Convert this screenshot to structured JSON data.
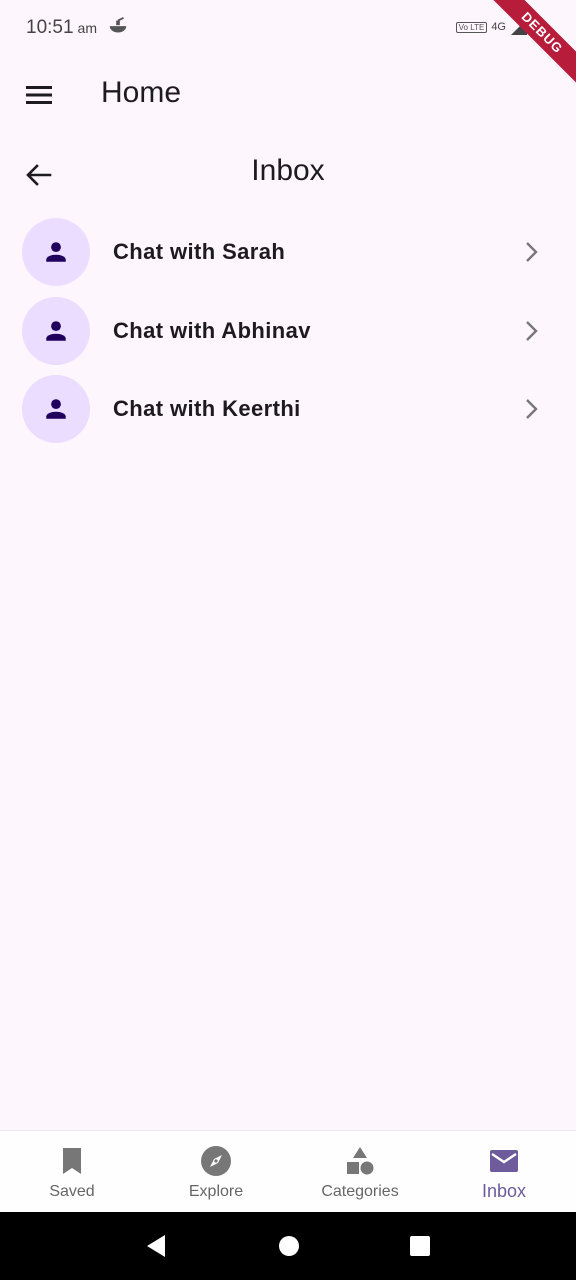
{
  "status": {
    "time": "10:51",
    "ampm": "am",
    "volte": "Vo LTE",
    "network": "4G"
  },
  "debug_label": "DEBUG",
  "app_bar": {
    "title": "Home"
  },
  "page": {
    "title": "Inbox"
  },
  "chats": [
    {
      "label": "Chat with Sarah"
    },
    {
      "label": "Chat with Abhinav"
    },
    {
      "label": "Chat with Keerthi"
    }
  ],
  "nav": {
    "items": [
      {
        "label": "Saved",
        "icon": "bookmark-icon"
      },
      {
        "label": "Explore",
        "icon": "compass-icon"
      },
      {
        "label": "Categories",
        "icon": "categories-icon"
      },
      {
        "label": "Inbox",
        "icon": "mail-icon",
        "active": true
      }
    ]
  },
  "colors": {
    "background": "#fdf6fc",
    "avatar_bg": "#eaddff",
    "avatar_fg": "#21005d",
    "active_nav": "#6d5b9c",
    "debug_ribbon": "#b71c3a"
  }
}
